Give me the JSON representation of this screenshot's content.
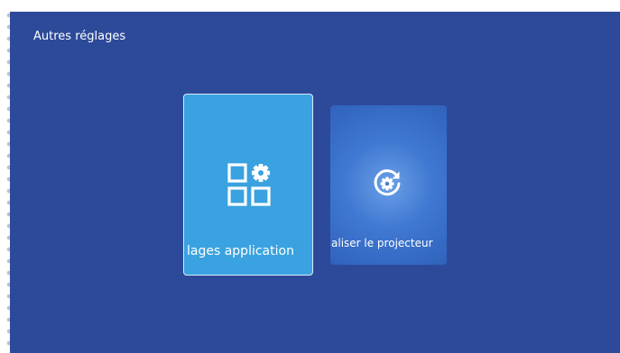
{
  "header": {
    "title": "Autres réglages"
  },
  "cards": [
    {
      "id": "app-settings",
      "label": "lages application",
      "icon": "apps-settings-icon",
      "selected": true
    },
    {
      "id": "reset-projector",
      "label": "aliser le projecteur",
      "icon": "reset-icon",
      "selected": false
    }
  ],
  "colors": {
    "background": "#2d4a9a",
    "selected_card": "#3aa2e0",
    "unselected_card": "#3f78d2",
    "text": "#ffffff"
  }
}
